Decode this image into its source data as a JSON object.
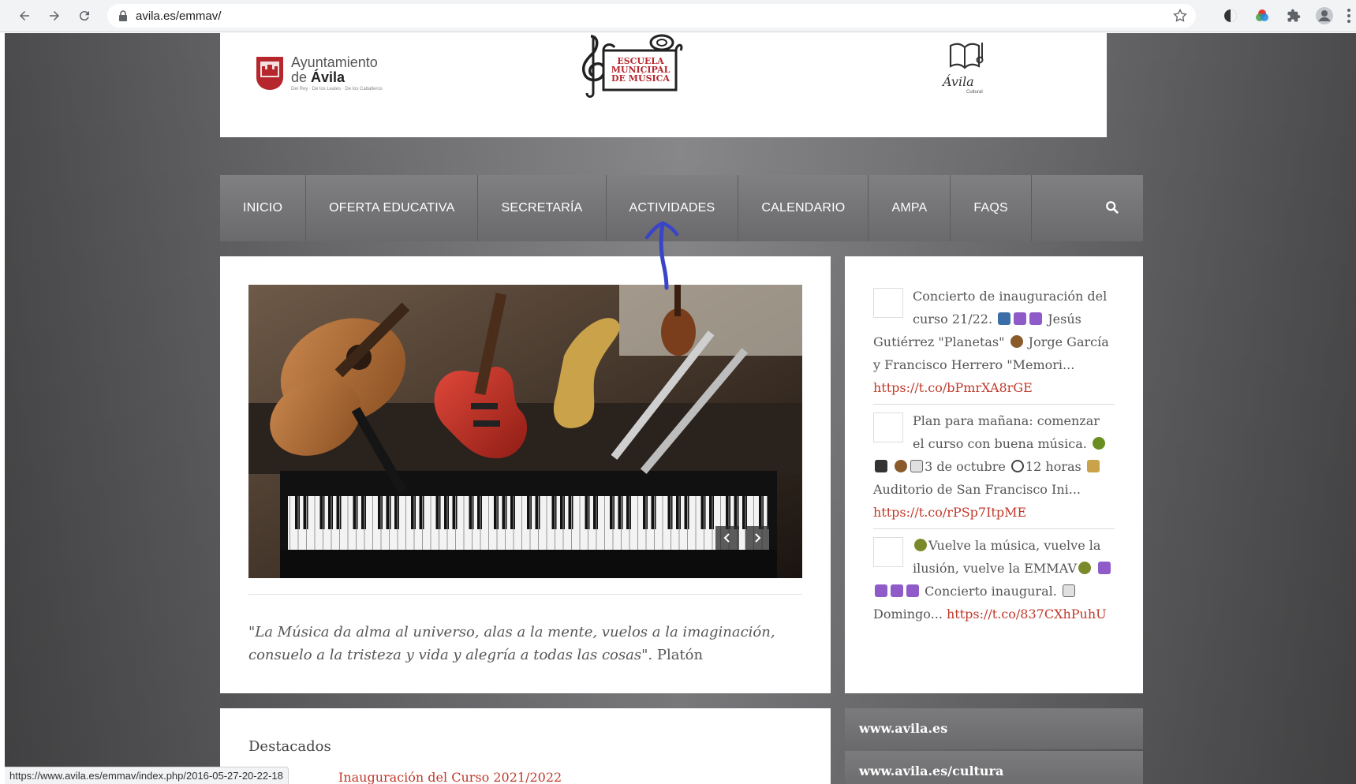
{
  "browser": {
    "url": "avila.es/emmav/",
    "status_url": "https://www.avila.es/emmav/index.php/2016-05-27-20-22-18",
    "icons": [
      "back-icon",
      "forward-icon",
      "reload-icon",
      "lock-icon",
      "star-icon",
      "extensions-icon",
      "profile-icon",
      "menu-icon"
    ]
  },
  "header": {
    "ayuntamiento_line1": "Ayuntamiento",
    "ayuntamiento_prefix": "de",
    "ayuntamiento_city": "Ávila",
    "ayuntamiento_motto": "Del Rey · De los Leales · De los Caballeros",
    "escuela_lines": [
      "ESCUELA",
      "MUNICIPAL",
      "DE MÚSICA"
    ],
    "cultural_logo": "Ávila",
    "cultural_sub": "Cultural"
  },
  "nav": {
    "items": [
      "INICIO",
      "OFERTA EDUCATIVA",
      "SECRETARÍA",
      "ACTIVIDADES",
      "CALENDARIO",
      "AMPA",
      "FAQS"
    ]
  },
  "main": {
    "quote_italic": "\"La Música da alma al universo, alas a la mente, vuelos a la imaginación, consuelo a la tristeza y vida y alegría a todas las cosas\".",
    "quote_author": " Platón"
  },
  "tweets": [
    {
      "text_a": "Concierto de inauguración del curso 21/22.",
      "text_b": " Jesús Gutiérrez \"Planetas\"",
      "text_c": " Jorge García y Francisco Herrero \"Memori...",
      "link": "https://t.co/bPmrXA8rGE"
    },
    {
      "text_a": "Plan para mañana: comenzar el curso con buena música.",
      "text_b": "3 de octubre",
      "text_c": "12 horas",
      "text_d": " Auditorio de San Francisco Ini...",
      "link": "https://t.co/rPSp7ItpME"
    },
    {
      "text_a": "Vuelve la música, vuelve la ilusión, vuelve la EMMAV",
      "text_b": " Concierto inaugural.",
      "text_c": " Domingo...",
      "link": "https://t.co/837CXhPuhU"
    }
  ],
  "destacados": {
    "title": "Destacados",
    "first_link": "Inauguración del Curso 2021/2022"
  },
  "side_links": [
    "www.avila.es",
    "www.avila.es/cultura"
  ],
  "colors": {
    "accent_link": "#c0392b",
    "nav_bg": "#727274",
    "annotation_arrow": "#3a44c8"
  }
}
